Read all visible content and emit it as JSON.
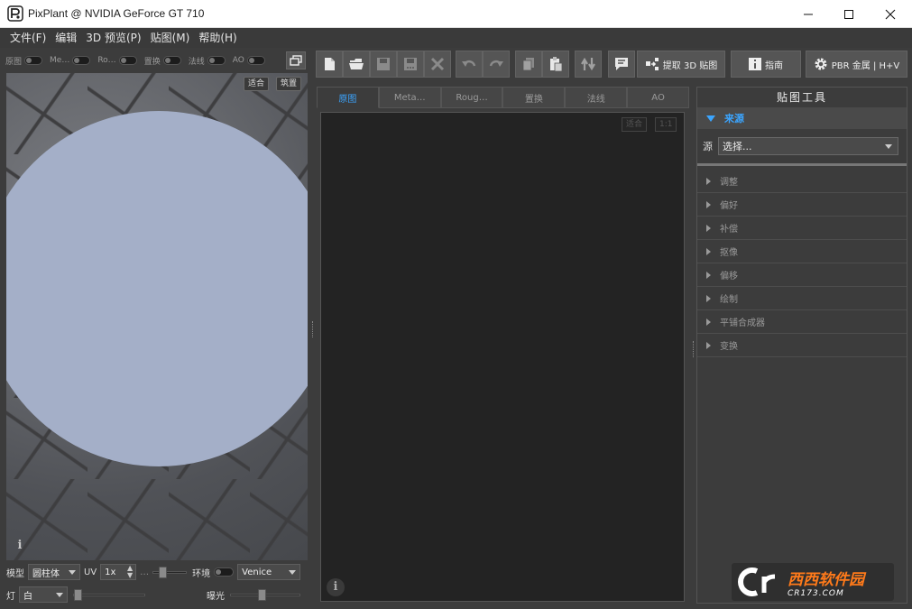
{
  "window": {
    "title": "PixPlant @ NVIDIA GeForce GT 710"
  },
  "menu": {
    "items": [
      "文件(F)",
      "编辑",
      "3D 预览(P)",
      "贴图(M)",
      "帮助(H)"
    ]
  },
  "channels": {
    "items": [
      "原图",
      "Me…",
      "Ro…",
      "置换",
      "法线",
      "AO"
    ]
  },
  "viewport3d": {
    "fit_label": "适合",
    "tile_label": "筑置",
    "sphere_color": "#a4afc8"
  },
  "model_controls": {
    "model_label": "模型",
    "model_value": "圆柱体",
    "uv_label": "UV",
    "uv_value": "1x",
    "ellipsis": "…",
    "env_label": "环境",
    "env_value": "Venice",
    "light_label": "灯",
    "light_value": "白",
    "exposure_label": "曝光"
  },
  "toolbar": {
    "extract_3d_label": "提取 3D 贴图",
    "guide_label": "指南",
    "pbr_label": "PBR 金属 | H+V"
  },
  "center": {
    "tabs": [
      "原图",
      "Meta…",
      "Roug…",
      "置换",
      "法线",
      "AO"
    ],
    "active_tab": "原图",
    "fit_label": "适合",
    "ratio_label": "1:1"
  },
  "tools_panel": {
    "title": "贴图工具",
    "source_section": "来源",
    "source_label": "源",
    "source_value": "选择...",
    "items": [
      "调整",
      "偏好",
      "补偿",
      "抠像",
      "偏移",
      "绘制",
      "平铺合成器",
      "变换"
    ]
  },
  "watermark": {
    "text_main": "西西软件园",
    "text_sub": "CR173.COM"
  },
  "colors": {
    "accent": "#3ba5ff",
    "panel": "#3c3c3c",
    "canvas": "#232323"
  }
}
